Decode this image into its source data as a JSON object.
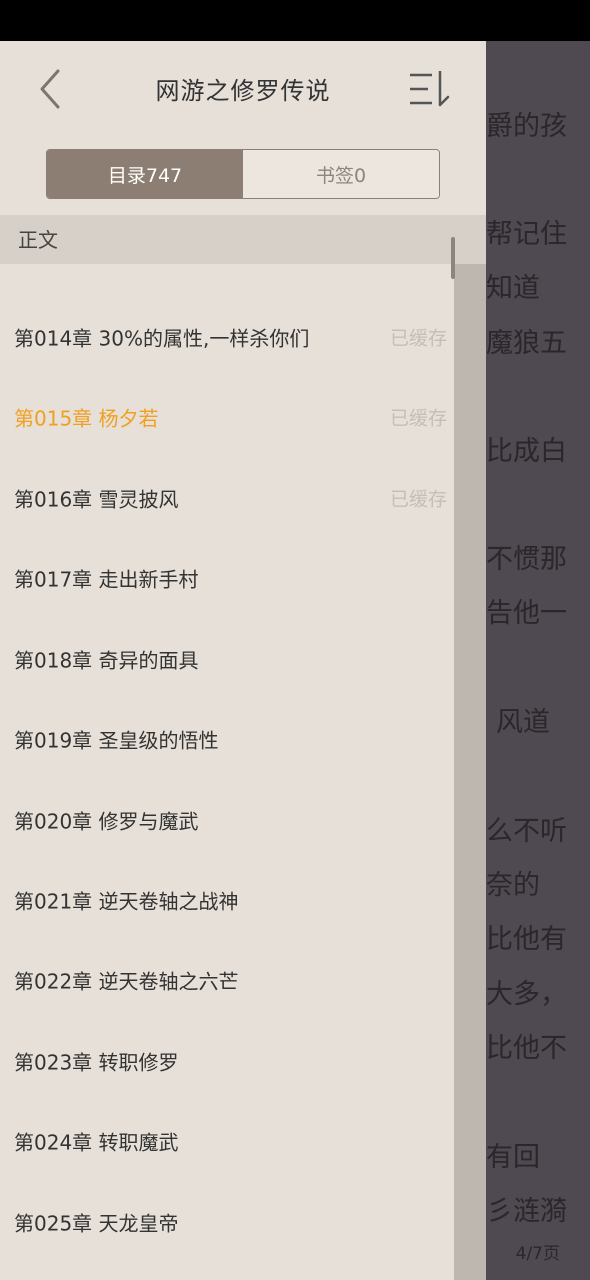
{
  "header": {
    "title": "网游之修罗传说"
  },
  "tabs": {
    "catalog": "目录747",
    "bookmarks": "书签0"
  },
  "section": {
    "title": "正文"
  },
  "chapters": [
    {
      "title": "第014章 30%的属性,一样杀你们",
      "status": "已缓存"
    },
    {
      "title": "第015章 杨夕若",
      "status": "已缓存"
    },
    {
      "title": "第016章 雪灵披风",
      "status": "已缓存"
    },
    {
      "title": "第017章 走出新手村"
    },
    {
      "title": "第018章 奇异的面具"
    },
    {
      "title": "第019章 圣皇级的悟性"
    },
    {
      "title": "第020章 修罗与魔武"
    },
    {
      "title": "第021章 逆天卷轴之战神"
    },
    {
      "title": "第022章 逆天卷轴之六芒"
    },
    {
      "title": "第023章 转职修罗"
    },
    {
      "title": "第024章 转职魔武"
    },
    {
      "title": "第025章 天龙皇帝"
    }
  ],
  "reader": {
    "lines": [
      "爵的孩",
      "帮记住",
      "知道",
      "魔狼五",
      "比成白",
      "不惯那",
      "告他一",
      "风道",
      "么不听",
      "奈的",
      "比他有",
      "大多，",
      "比他不",
      "有回",
      "彡涟漪"
    ],
    "page_indicator": "4/7页"
  },
  "colors": {
    "accent": "#f0a020",
    "tab_active": "#8c7e73",
    "drawer_bg": "#e6e0d8"
  }
}
